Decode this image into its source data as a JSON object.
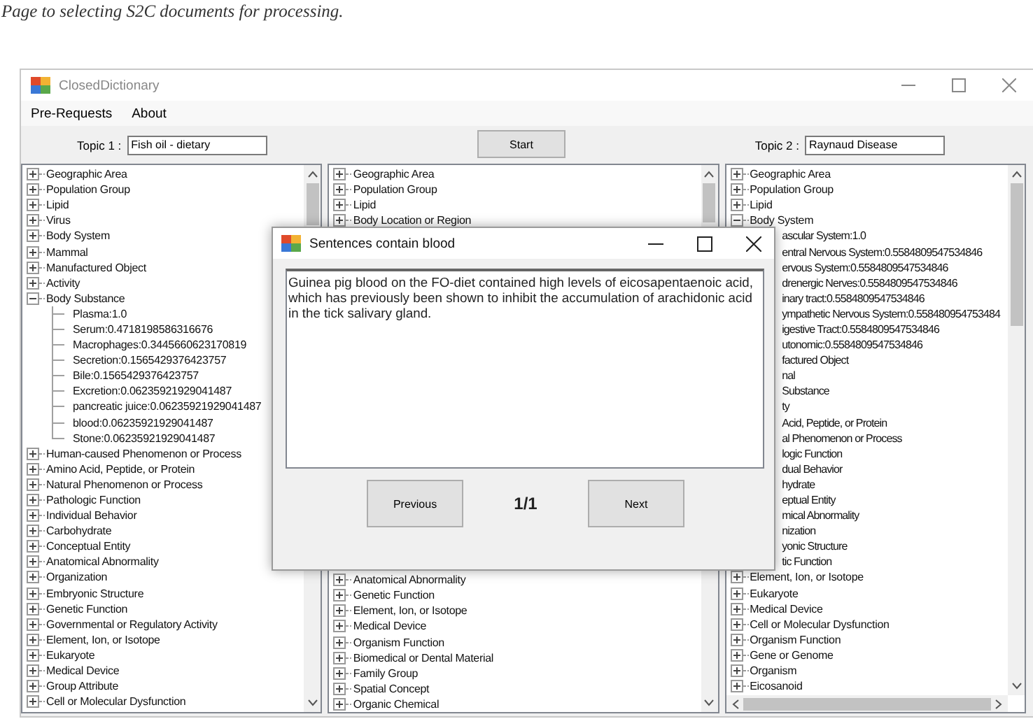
{
  "caption": "Page to selecting S2C documents for processing.",
  "window": {
    "title": "ClosedDictionary"
  },
  "menu": [
    "Pre-Requests",
    "About"
  ],
  "topic_1": {
    "label": "Topic 1 :",
    "value": "Fish oil - dietary"
  },
  "start_button": "Start",
  "topic_2": {
    "label": "Topic 2 :",
    "value": "Raynaud Disease"
  },
  "left_tree": {
    "items": [
      {
        "label": "Geographic Area",
        "kind": "node",
        "expanded": false
      },
      {
        "label": "Population Group",
        "kind": "node",
        "expanded": false
      },
      {
        "label": "Lipid",
        "kind": "node",
        "expanded": false
      },
      {
        "label": "Virus",
        "kind": "node",
        "expanded": false
      },
      {
        "label": "Body System",
        "kind": "node",
        "expanded": false
      },
      {
        "label": "Mammal",
        "kind": "node",
        "expanded": false
      },
      {
        "label": "Manufactured Object",
        "kind": "node",
        "expanded": false
      },
      {
        "label": "Activity",
        "kind": "node",
        "expanded": false
      },
      {
        "label": "Body Substance",
        "kind": "node",
        "expanded": true,
        "children": [
          {
            "label": "Plasma:1.0",
            "kind": "leaf"
          },
          {
            "label": "Serum:0.4718198586316676",
            "kind": "leaf"
          },
          {
            "label": "Macrophages:0.3445660623170819",
            "kind": "leaf"
          },
          {
            "label": "Secretion:0.1565429376423757",
            "kind": "leaf"
          },
          {
            "label": "Bile:0.1565429376423757",
            "kind": "leaf"
          },
          {
            "label": "Excretion:0.06235921929041487",
            "kind": "leaf"
          },
          {
            "label": "pancreatic juice:0.06235921929041487",
            "kind": "leaf"
          },
          {
            "label": "blood:0.06235921929041487",
            "kind": "leaf"
          },
          {
            "label": "Stone:0.06235921929041487",
            "kind": "leaf"
          }
        ]
      },
      {
        "label": "Human-caused Phenomenon or Process",
        "kind": "node",
        "expanded": false
      },
      {
        "label": "Amino Acid, Peptide, or Protein",
        "kind": "node",
        "expanded": false
      },
      {
        "label": "Natural Phenomenon or Process",
        "kind": "node",
        "expanded": false
      },
      {
        "label": "Pathologic Function",
        "kind": "node",
        "expanded": false
      },
      {
        "label": "Individual Behavior",
        "kind": "node",
        "expanded": false
      },
      {
        "label": "Carbohydrate",
        "kind": "node",
        "expanded": false
      },
      {
        "label": "Conceptual Entity",
        "kind": "node",
        "expanded": false
      },
      {
        "label": "Anatomical Abnormality",
        "kind": "node",
        "expanded": false
      },
      {
        "label": "Organization",
        "kind": "node",
        "expanded": false
      },
      {
        "label": "Embryonic Structure",
        "kind": "node",
        "expanded": false
      },
      {
        "label": "Genetic Function",
        "kind": "node",
        "expanded": false
      },
      {
        "label": "Governmental or Regulatory Activity",
        "kind": "node",
        "expanded": false
      },
      {
        "label": "Element, Ion, or Isotope",
        "kind": "node",
        "expanded": false
      },
      {
        "label": "Eukaryote",
        "kind": "node",
        "expanded": false
      },
      {
        "label": "Medical Device",
        "kind": "node",
        "expanded": false
      },
      {
        "label": "Group Attribute",
        "kind": "node",
        "expanded": false
      },
      {
        "label": "Cell or Molecular Dysfunction",
        "kind": "node",
        "expanded": false
      }
    ]
  },
  "middle_tree": {
    "top_items": [
      {
        "label": "Geographic Area",
        "kind": "node",
        "expanded": false
      },
      {
        "label": "Population Group",
        "kind": "node",
        "expanded": false
      },
      {
        "label": "Lipid",
        "kind": "node",
        "expanded": false
      },
      {
        "label": "Body Location or Region",
        "kind": "node",
        "expanded": false
      }
    ],
    "bottom_items": [
      {
        "label": "Anatomical Abnormality",
        "kind": "node",
        "expanded": false
      },
      {
        "label": "Genetic Function",
        "kind": "node",
        "expanded": false
      },
      {
        "label": "Element, Ion, or Isotope",
        "kind": "node",
        "expanded": false
      },
      {
        "label": "Medical Device",
        "kind": "node",
        "expanded": false
      },
      {
        "label": "Organism Function",
        "kind": "node",
        "expanded": false
      },
      {
        "label": "Biomedical or Dental Material",
        "kind": "node",
        "expanded": false
      },
      {
        "label": "Family Group",
        "kind": "node",
        "expanded": false
      },
      {
        "label": "Spatial Concept",
        "kind": "node",
        "expanded": false
      },
      {
        "label": "Organic Chemical",
        "kind": "node",
        "expanded": false
      }
    ]
  },
  "right_tree": {
    "items": [
      {
        "label": "Geographic Area",
        "kind": "node",
        "expanded": false
      },
      {
        "label": "Population Group",
        "kind": "node",
        "expanded": false
      },
      {
        "label": "Lipid",
        "kind": "node",
        "expanded": false
      },
      {
        "label": "Body System",
        "kind": "node",
        "expanded": true,
        "children": [
          {
            "label": "ascular System:1.0",
            "kind": "partial"
          },
          {
            "label": "entral Nervous System:0.5584809547534846",
            "kind": "partial"
          },
          {
            "label": "ervous System:0.5584809547534846",
            "kind": "partial"
          },
          {
            "label": "drenergic Nerves:0.5584809547534846",
            "kind": "partial"
          },
          {
            "label": "inary tract:0.5584809547534846",
            "kind": "partial"
          },
          {
            "label": "ympathetic Nervous System:0.558480954753484",
            "kind": "partial"
          },
          {
            "label": "igestive Tract:0.5584809547534846",
            "kind": "partial"
          },
          {
            "label": "utonomic:0.5584809547534846",
            "kind": "partial"
          }
        ]
      },
      {
        "label": "factured Object",
        "kind": "partial"
      },
      {
        "label": "nal",
        "kind": "partial"
      },
      {
        "label": "Substance",
        "kind": "partial"
      },
      {
        "label": "ty",
        "kind": "partial"
      },
      {
        "label": "Acid, Peptide, or Protein",
        "kind": "partial"
      },
      {
        "label": "al Phenomenon or Process",
        "kind": "partial"
      },
      {
        "label": "logic Function",
        "kind": "partial"
      },
      {
        "label": "dual Behavior",
        "kind": "partial"
      },
      {
        "label": "hydrate",
        "kind": "partial"
      },
      {
        "label": "eptual Entity",
        "kind": "partial"
      },
      {
        "label": "mical Abnormality",
        "kind": "partial"
      },
      {
        "label": "nization",
        "kind": "partial"
      },
      {
        "label": "yonic Structure",
        "kind": "partial"
      },
      {
        "label": "tic Function",
        "kind": "partial"
      },
      {
        "label": "Element, Ion, or Isotope",
        "kind": "node",
        "expanded": false
      },
      {
        "label": "Eukaryote",
        "kind": "node",
        "expanded": false
      },
      {
        "label": "Medical Device",
        "kind": "node",
        "expanded": false
      },
      {
        "label": "Cell or Molecular Dysfunction",
        "kind": "node",
        "expanded": false
      },
      {
        "label": "Organism Function",
        "kind": "node",
        "expanded": false
      },
      {
        "label": "Gene or Genome",
        "kind": "node",
        "expanded": false
      },
      {
        "label": "Organism",
        "kind": "node",
        "expanded": false
      },
      {
        "label": "Eicosanoid",
        "kind": "node",
        "expanded": false
      }
    ]
  },
  "dialog": {
    "title": "Sentences contain blood",
    "text": "Guinea pig blood on the FO-diet contained high levels of eicosapentaenoic acid, which has previously been shown to inhibit the accumulation of arachidonic acid in the tick salivary gland.",
    "previous_button": "Previous",
    "counter": "1/1",
    "next_button": "Next"
  }
}
